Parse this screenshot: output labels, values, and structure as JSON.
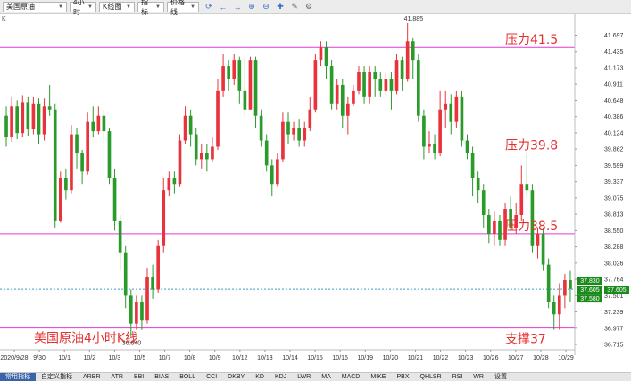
{
  "toolbar": {
    "symbol": "美国原油",
    "period": "4小时",
    "chart_type": "K线图",
    "indicator": "指标",
    "price_line": "价格线",
    "icons": [
      "refresh-icon",
      "arrow-left-icon",
      "arrow-right-icon",
      "zoom-in-icon",
      "zoom-out-icon",
      "crosshair-icon",
      "pencil-icon",
      "gear-icon"
    ]
  },
  "corner_label": "K",
  "tabs": [
    "常用指标",
    "自定义指标",
    "ARBR",
    "ATR",
    "BBI",
    "BIAS",
    "BOLL",
    "CCI",
    "DKBY",
    "KD",
    "KDJ",
    "LWR",
    "MA",
    "MACD",
    "MIKE",
    "PBX",
    "QHLSR",
    "RSI",
    "WR",
    "设置"
  ],
  "colors": {
    "up": "#e8333c",
    "down": "#2a9a2a",
    "hline": "#e23ad6",
    "current": "#1a8a1a"
  },
  "chart_data": {
    "type": "candlestick",
    "title": "美国原油4小时K线",
    "ylim": [
      36.715,
      41.92
    ],
    "y_ticks": [
      "41.697",
      "41.435",
      "41.173",
      "40.911",
      "40.648",
      "40.386",
      "40.124",
      "39.862",
      "39.599",
      "39.337",
      "39.075",
      "38.813",
      "38.550",
      "38.288",
      "38.026",
      "37.764",
      "37.501",
      "37.239",
      "36.977",
      "36.715"
    ],
    "x_labels": [
      "2020/9/28",
      "9/30",
      "10/1",
      "10/2",
      "10/3",
      "10/5",
      "10/7",
      "10/8",
      "10/9",
      "10/12",
      "10/13",
      "10/14",
      "10/15",
      "10/16",
      "10/19",
      "10/20",
      "10/21",
      "10/22",
      "10/23",
      "10/26",
      "10/27",
      "10/28",
      "10/29"
    ],
    "high_label": "41.885",
    "low_label": "36.840",
    "current_price": "37.605",
    "price_tags": [
      "37.830",
      "37.605",
      "37.580"
    ],
    "annotations": [
      {
        "text": "压力41.5",
        "price": 41.5
      },
      {
        "text": "压力39.8",
        "price": 39.8
      },
      {
        "text": "压力38.5",
        "price": 38.5
      },
      {
        "text": "支撑37",
        "price": 36.98
      }
    ],
    "candles": [
      [
        40.4,
        40.05,
        40.55,
        39.9
      ],
      [
        40.05,
        40.55,
        40.7,
        39.98
      ],
      [
        40.55,
        40.12,
        40.65,
        40.02
      ],
      [
        40.12,
        40.62,
        40.72,
        40.05
      ],
      [
        40.62,
        40.18,
        40.7,
        40.08
      ],
      [
        40.18,
        40.6,
        40.7,
        40.1
      ],
      [
        40.6,
        40.1,
        40.68,
        39.95
      ],
      [
        40.1,
        40.55,
        40.68,
        40.0
      ],
      [
        40.55,
        40.5,
        40.9,
        40.4
      ],
      [
        40.5,
        38.7,
        40.6,
        38.6
      ],
      [
        38.7,
        39.4,
        39.5,
        38.68
      ],
      [
        39.4,
        39.2,
        39.55,
        39.05
      ],
      [
        39.2,
        40.1,
        40.25,
        39.15
      ],
      [
        40.1,
        39.8,
        40.2,
        39.55
      ],
      [
        39.8,
        39.5,
        39.85,
        39.3
      ],
      [
        39.5,
        40.3,
        40.45,
        39.45
      ],
      [
        40.3,
        40.15,
        40.55,
        40.05
      ],
      [
        40.15,
        40.4,
        40.55,
        40.1
      ],
      [
        40.4,
        40.15,
        40.5,
        40.0
      ],
      [
        40.15,
        39.4,
        40.2,
        39.3
      ],
      [
        39.4,
        38.7,
        39.55,
        38.55
      ],
      [
        38.7,
        38.2,
        38.8,
        37.9
      ],
      [
        38.2,
        37.5,
        38.3,
        37.3
      ],
      [
        37.5,
        37.05,
        37.6,
        36.84
      ],
      [
        37.05,
        37.4,
        37.5,
        36.95
      ],
      [
        37.4,
        37.1,
        37.5,
        36.95
      ],
      [
        37.1,
        37.8,
        37.95,
        37.05
      ],
      [
        37.8,
        37.6,
        38.0,
        37.45
      ],
      [
        37.6,
        38.3,
        38.4,
        37.55
      ],
      [
        38.3,
        39.2,
        39.4,
        38.2
      ],
      [
        39.2,
        39.4,
        39.5,
        39.1
      ],
      [
        39.4,
        39.3,
        39.5,
        39.15
      ],
      [
        39.3,
        40.0,
        40.1,
        39.25
      ],
      [
        40.0,
        40.4,
        40.55,
        39.95
      ],
      [
        40.4,
        40.1,
        40.5,
        39.9
      ],
      [
        40.1,
        39.7,
        40.2,
        39.6
      ],
      [
        39.7,
        39.8,
        39.95,
        39.55
      ],
      [
        39.8,
        39.7,
        39.95,
        39.5
      ],
      [
        39.7,
        39.9,
        40.05,
        39.65
      ],
      [
        39.9,
        40.8,
        41.0,
        39.85
      ],
      [
        40.8,
        41.2,
        41.4,
        40.7
      ],
      [
        41.2,
        41.0,
        41.3,
        40.8
      ],
      [
        41.0,
        41.3,
        41.4,
        40.9
      ],
      [
        41.3,
        40.8,
        41.35,
        40.6
      ],
      [
        40.8,
        40.5,
        41.35,
        40.4
      ],
      [
        40.5,
        41.3,
        41.35,
        40.5
      ],
      [
        41.3,
        40.4,
        41.35,
        40.2
      ],
      [
        40.4,
        40.0,
        40.5,
        39.9
      ],
      [
        40.0,
        39.6,
        40.1,
        39.5
      ],
      [
        39.6,
        39.3,
        39.7,
        39.1
      ],
      [
        39.3,
        39.7,
        39.8,
        39.25
      ],
      [
        39.7,
        40.3,
        40.45,
        39.65
      ],
      [
        40.3,
        40.1,
        40.45,
        39.95
      ],
      [
        40.1,
        40.2,
        40.3,
        40.0
      ],
      [
        40.2,
        40.0,
        40.35,
        39.9
      ],
      [
        40.0,
        40.2,
        40.3,
        39.9
      ],
      [
        40.2,
        40.5,
        40.7,
        40.15
      ],
      [
        40.5,
        41.3,
        41.4,
        40.45
      ],
      [
        41.3,
        41.5,
        41.6,
        41.2
      ],
      [
        41.5,
        41.2,
        41.6,
        41.0
      ],
      [
        41.2,
        40.6,
        41.3,
        40.5
      ],
      [
        40.6,
        40.9,
        41.0,
        40.5
      ],
      [
        40.9,
        40.4,
        41.0,
        40.2
      ],
      [
        40.4,
        40.6,
        40.7,
        40.1
      ],
      [
        40.6,
        40.8,
        40.9,
        40.55
      ],
      [
        40.8,
        41.1,
        41.2,
        40.75
      ],
      [
        41.1,
        40.7,
        41.2,
        40.6
      ],
      [
        40.7,
        41.1,
        41.2,
        40.6
      ],
      [
        41.1,
        41.0,
        41.2,
        40.7
      ],
      [
        41.0,
        40.8,
        41.1,
        40.7
      ],
      [
        40.8,
        41.0,
        41.1,
        40.7
      ],
      [
        41.0,
        40.8,
        41.1,
        40.5
      ],
      [
        40.8,
        41.3,
        41.4,
        40.75
      ],
      [
        41.3,
        41.0,
        41.35,
        40.8
      ],
      [
        41.0,
        41.6,
        41.89,
        40.95
      ],
      [
        41.6,
        41.3,
        41.65,
        41.0
      ],
      [
        41.3,
        40.4,
        41.4,
        40.3
      ],
      [
        40.4,
        39.9,
        40.5,
        39.7
      ],
      [
        39.9,
        39.95,
        40.15,
        39.8
      ],
      [
        39.95,
        39.8,
        40.1,
        39.7
      ],
      [
        39.8,
        40.5,
        40.8,
        39.75
      ],
      [
        40.5,
        40.6,
        40.8,
        40.2
      ],
      [
        40.6,
        40.3,
        40.75,
        40.1
      ],
      [
        40.3,
        40.7,
        40.8,
        40.2
      ],
      [
        40.7,
        40.0,
        40.8,
        39.9
      ],
      [
        40.0,
        39.8,
        40.1,
        39.7
      ],
      [
        39.8,
        39.4,
        39.9,
        39.1
      ],
      [
        39.4,
        39.2,
        39.5,
        39.0
      ],
      [
        39.2,
        38.8,
        39.3,
        38.6
      ],
      [
        38.8,
        38.5,
        38.9,
        38.35
      ],
      [
        38.5,
        38.7,
        38.85,
        38.3
      ],
      [
        38.7,
        38.4,
        38.8,
        38.3
      ],
      [
        38.4,
        38.9,
        39.0,
        38.3
      ],
      [
        38.9,
        38.6,
        39.1,
        38.55
      ],
      [
        38.6,
        38.8,
        39.0,
        38.5
      ],
      [
        38.8,
        39.3,
        39.6,
        38.7
      ],
      [
        39.3,
        39.2,
        39.8,
        39.1
      ],
      [
        39.2,
        38.3,
        39.3,
        38.2
      ],
      [
        38.3,
        38.5,
        38.6,
        38.1
      ],
      [
        38.5,
        38.0,
        38.6,
        37.9
      ],
      [
        38.0,
        37.4,
        38.1,
        37.3
      ],
      [
        37.4,
        37.2,
        37.5,
        36.95
      ],
      [
        37.2,
        37.5,
        37.7,
        36.95
      ],
      [
        37.5,
        37.75,
        37.85,
        37.3
      ],
      [
        37.75,
        37.61,
        37.9,
        37.4
      ]
    ]
  }
}
